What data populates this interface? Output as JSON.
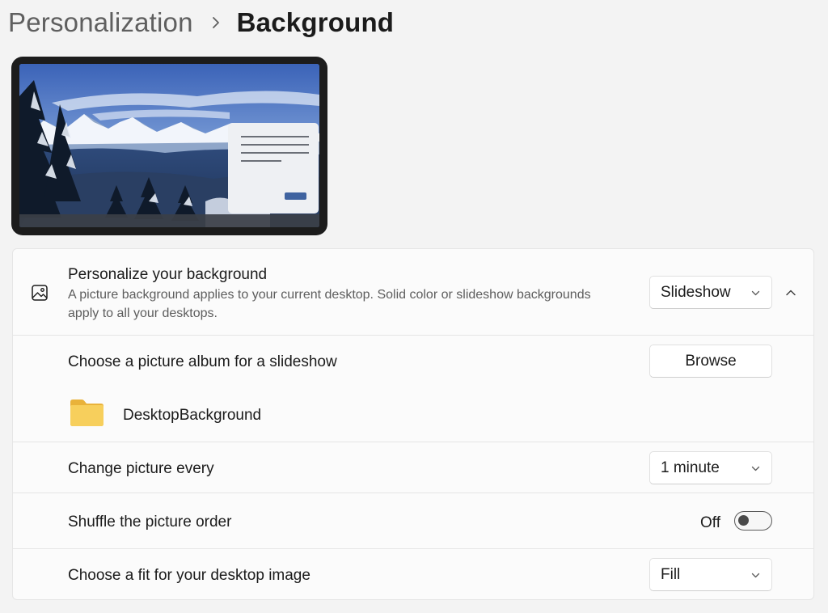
{
  "breadcrumb": {
    "parent": "Personalization",
    "separator_icon": "chevron-right-icon",
    "current": "Background"
  },
  "preview": {
    "description_icon": "desktop-preview"
  },
  "personalize": {
    "icon": "picture-icon",
    "title": "Personalize your background",
    "description": "A picture background applies to your current desktop. Solid color or slideshow backgrounds apply to all your desktops.",
    "selected": "Slideshow",
    "expanded": true
  },
  "album": {
    "title": "Choose a picture album for a slideshow",
    "button_label": "Browse",
    "folder_icon": "folder-icon",
    "folder_name": "DesktopBackground"
  },
  "change_picture": {
    "title": "Change picture every",
    "selected": "1 minute"
  },
  "shuffle": {
    "title": "Shuffle the picture order",
    "state_label": "Off",
    "on": false
  },
  "fit": {
    "title": "Choose a fit for your desktop image",
    "selected": "Fill"
  },
  "colors": {
    "accent": "#3f63a0",
    "page_bg": "#f3f3f3",
    "card_bg": "#fbfbfb",
    "folder": "#f5c84c"
  }
}
